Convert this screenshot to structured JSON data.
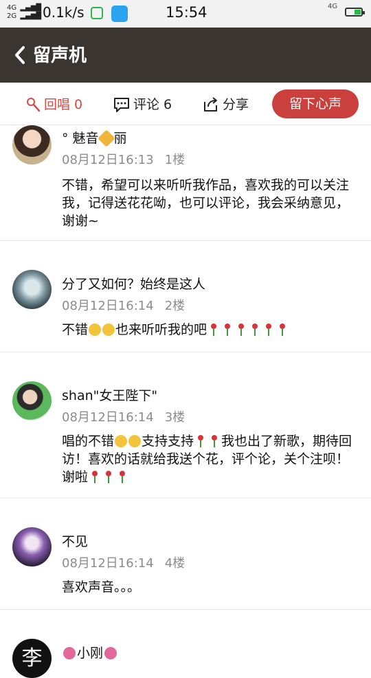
{
  "status_bar": {
    "net_top": "4G",
    "net_bottom": "2G",
    "rate": "0.1k/s",
    "time": "15:54",
    "right_net": "4G"
  },
  "header": {
    "title": "留声机"
  },
  "actions": {
    "reply_label": "回唱 0",
    "comment_label": "评论 6",
    "share_label": "分享",
    "leave_button": "留下心声"
  },
  "comments": [
    {
      "name_prefix": "°  魅音",
      "name_suffix": "丽",
      "time": "08月12日16:13",
      "floor": "1楼",
      "text": "不错，希望可以来听听我作品，喜欢我的可以关注我，记得送花花呦，也可以评论，我会采纳意见，谢谢~"
    },
    {
      "name": "分了又如何？始终是这人",
      "time": "08月12日16:14",
      "floor": "2楼",
      "text_a": "不错",
      "text_b": "也来听听我的吧"
    },
    {
      "name": "shan\"女王陛下\"",
      "time": "08月12日16:14",
      "floor": "3楼",
      "text_a": "唱的不错",
      "text_b": "支持支持",
      "text_c": "我也出了新歌，期待回访！喜欢的话就给我送个花，评个论，关个注呗！谢啦"
    },
    {
      "name": "不见",
      "time": "08月12日16:14",
      "floor": "4楼",
      "text": "喜欢声音。。。"
    },
    {
      "name": "小刚",
      "avatar_char": "李"
    }
  ],
  "icons": {
    "back": "chevron-left-icon",
    "reply": "microphone-icon",
    "comment": "comment-bubble-icon",
    "share": "share-icon"
  },
  "colors": {
    "header_bg": "#3a3531",
    "accent": "#c9403c",
    "reply_color": "#d84a43"
  }
}
